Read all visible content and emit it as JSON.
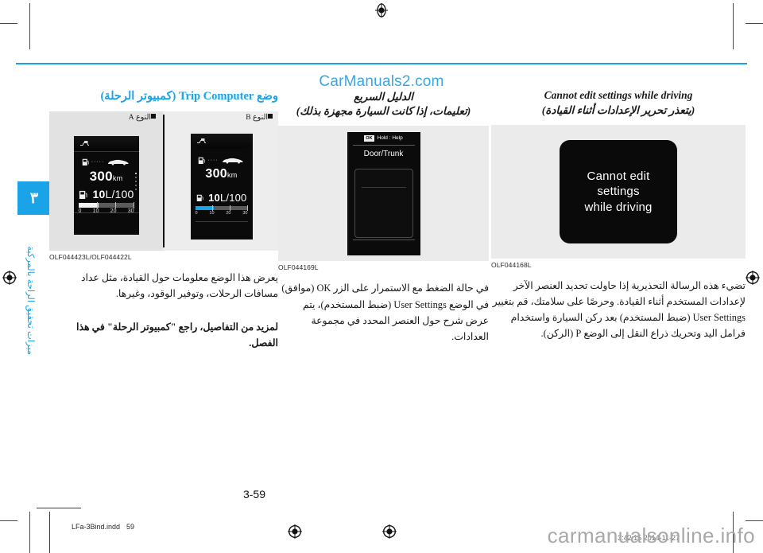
{
  "watermarks": {
    "top": "CarManuals2.com",
    "bottom": "carmanualsonline.info",
    "print_stamp": "2014-11-27   3:42:15"
  },
  "sidebar": {
    "chapter_number": "٣",
    "chapter_label": "ميزات تحقيق الراحة بالمركبة",
    "accent_color": "#1ba3e8"
  },
  "columns": {
    "right": {
      "title_en": "Cannot edit settings while driving",
      "title_ar": "(يتعذر تحرير الإعدادات أثناء القيادة)",
      "figure_caption": "OLF044168L",
      "screen": {
        "line1": "Cannot edit",
        "line2": "settings",
        "line3": "while driving"
      },
      "body": "تضيء هذه الرسالة التحذيرية إذا حاولت تحديد العنصر الآخر لإعدادات المستخدم أثناء القيادة. وحرصًا على سلامتك، قم بتغيير User Settings (ضبط المستخدم) بعد ركن السيارة واستخدام فرامل اليد وتحريك ذراع النقل إلى الوضع P (الركن)."
    },
    "middle": {
      "title_ar_1": "الدليل السريع",
      "title_ar_2": "(تعليمات، إذا كانت السيارة مجهزة بذلك)",
      "figure_caption": "OLF044169L",
      "screen": {
        "help_ok": "OK",
        "help_text": "Hold : Help",
        "title": "Door/Trunk"
      },
      "body": "في حالة الضغط مع الاستمرار على الزر OK (موافق) في الوضع User Settings (ضبط المستخدم)، يتم عرض شرح حول العنصر المحدد في مجموعة العدادات."
    },
    "left": {
      "heading": "وضع Trip Computer (كمبيوتر الرحلة)",
      "type_a_label": "النوع A",
      "type_b_label": "النوع B",
      "figure_caption": "OLF044423L/OLF044422L",
      "screen_b": {
        "range_value": "300",
        "range_unit": "km",
        "consumption_value": "10",
        "consumption_unit": "L/100",
        "scale": [
          "0",
          "10",
          "20",
          "30"
        ]
      },
      "screen_a": {
        "range_value": "300",
        "range_unit": "km",
        "consumption_value": "10",
        "consumption_unit": "L/100",
        "scale": [
          "0",
          "10",
          "20",
          "30"
        ]
      },
      "body_1": "يعرض هذا الوضع معلومات حول القيادة، مثل عداد مسافات الرحلات، وتوفير الوقود، وغيرها.",
      "body_2": "لمزيد من التفاصيل، راجع \"كمبيوتر الرحلة\" في هذا الفصل."
    }
  },
  "footer": {
    "folio": "3-59",
    "indd_file": "LFa-3Bind.indd",
    "indd_page": "59"
  }
}
